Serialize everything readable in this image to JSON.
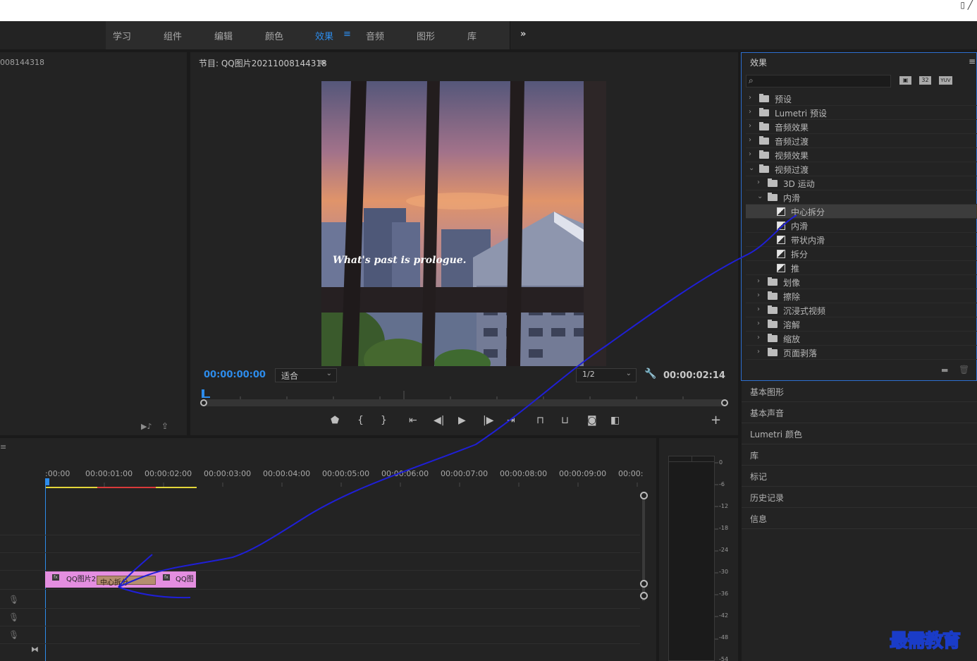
{
  "workspaces": {
    "items": [
      "学习",
      "组件",
      "编辑",
      "颜色",
      "效果",
      "音频",
      "图形",
      "库"
    ],
    "active": "效果",
    "more": "»",
    "menu_glyph": "≡"
  },
  "source": {
    "title_fragment": "008144318"
  },
  "program": {
    "title": "节目: QQ图片20211008144318",
    "menu": "≡",
    "image_caption": "What's past is prologue.",
    "timecode": "00:00:00:00",
    "fit": "适合",
    "resolution": "1/2",
    "duration": "00:00:02:14"
  },
  "effects": {
    "title": "效果",
    "menu": "≡",
    "search_placeholder": "",
    "badges": [
      "32",
      "YUV"
    ],
    "tree": [
      {
        "label": "预设",
        "kind": "folder-star",
        "level": 0,
        "expanded": false
      },
      {
        "label": "Lumetri 预设",
        "kind": "folder-star",
        "level": 0,
        "expanded": false
      },
      {
        "label": "音频效果",
        "kind": "folder",
        "level": 0,
        "expanded": false
      },
      {
        "label": "音频过渡",
        "kind": "folder",
        "level": 0,
        "expanded": false
      },
      {
        "label": "视频效果",
        "kind": "folder",
        "level": 0,
        "expanded": false
      },
      {
        "label": "视频过渡",
        "kind": "folder",
        "level": 0,
        "expanded": true
      },
      {
        "label": "3D 运动",
        "kind": "folder",
        "level": 1,
        "expanded": false
      },
      {
        "label": "内滑",
        "kind": "folder",
        "level": 1,
        "expanded": true
      },
      {
        "label": "中心拆分",
        "kind": "transition",
        "level": 2,
        "selected": true
      },
      {
        "label": "内滑",
        "kind": "transition",
        "level": 2
      },
      {
        "label": "带状内滑",
        "kind": "transition",
        "level": 2
      },
      {
        "label": "拆分",
        "kind": "transition",
        "level": 2
      },
      {
        "label": "推",
        "kind": "transition",
        "level": 2
      },
      {
        "label": "划像",
        "kind": "folder",
        "level": 1,
        "expanded": false
      },
      {
        "label": "擦除",
        "kind": "folder",
        "level": 1,
        "expanded": false
      },
      {
        "label": "沉浸式视频",
        "kind": "folder",
        "level": 1,
        "expanded": false
      },
      {
        "label": "溶解",
        "kind": "folder",
        "level": 1,
        "expanded": false
      },
      {
        "label": "缩放",
        "kind": "folder",
        "level": 1,
        "expanded": false
      },
      {
        "label": "页面剥落",
        "kind": "folder",
        "level": 1,
        "expanded": false
      }
    ]
  },
  "side_panels": [
    "基本图形",
    "基本声音",
    "Lumetri 颜色",
    "库",
    "标记",
    "历史记录",
    "信息"
  ],
  "timeline": {
    "ticks": [
      ":00:00",
      "00:00:01:00",
      "00:00:02:00",
      "00:00:03:00",
      "00:00:04:00",
      "00:00:05:00",
      "00:00:06:00",
      "00:00:07:00",
      "00:00:08:00",
      "00:00:09:00",
      "00:00:"
    ],
    "clip1_label": "QQ图片2",
    "transition_label": "中心拆分",
    "clip2_label": "QQ图",
    "fx_badge": "fx",
    "clip_color": "#e48ee0"
  },
  "meter": {
    "labels": [
      "0",
      "-6",
      "-12",
      "-18",
      "-24",
      "-30",
      "-36",
      "-42",
      "-48",
      "-54"
    ]
  },
  "watermark": "最需教育",
  "colors": {
    "accent": "#2d8ceb",
    "annotation": "#1f1fd6"
  }
}
